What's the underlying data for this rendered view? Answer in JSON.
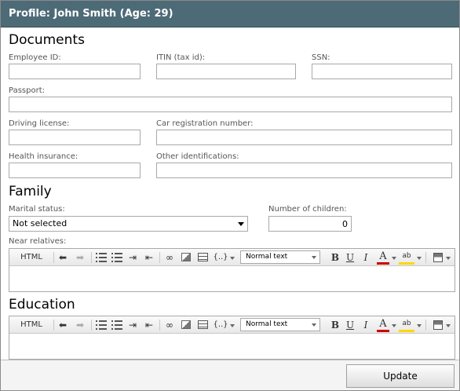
{
  "window": {
    "title": "Profile: John Smith (Age: 29)"
  },
  "documents": {
    "title": "Documents",
    "employee_id": {
      "label": "Employee ID:",
      "value": ""
    },
    "itin": {
      "label": "ITIN (tax id):",
      "value": ""
    },
    "ssn": {
      "label": "SSN:",
      "value": ""
    },
    "passport": {
      "label": "Passport:",
      "value": ""
    },
    "driving_license": {
      "label": "Driving license:",
      "value": ""
    },
    "car_registration": {
      "label": "Car registration number:",
      "value": ""
    },
    "health_insurance": {
      "label": "Health insurance:",
      "value": ""
    },
    "other_identifications": {
      "label": "Other identifications:",
      "value": ""
    }
  },
  "family": {
    "title": "Family",
    "marital_status": {
      "label": "Marital status:",
      "value": "Not selected"
    },
    "children": {
      "label": "Number of children:",
      "value": "0"
    },
    "near_relatives": {
      "label": "Near relatives:"
    }
  },
  "education": {
    "title": "Education"
  },
  "editor_toolbar": {
    "html_label": "HTML",
    "code_label": "{..}",
    "style_value": "Normal text",
    "bold_label": "B",
    "underline_label": "U",
    "italic_label": "I",
    "font_color_label": "A",
    "highlight_label": "ab"
  },
  "actions": {
    "update_label": "Update"
  },
  "colors": {
    "titlebar_bg": "#4d6a77",
    "font_color_underline": "#cc0000",
    "highlight_underline": "#ffd700"
  }
}
